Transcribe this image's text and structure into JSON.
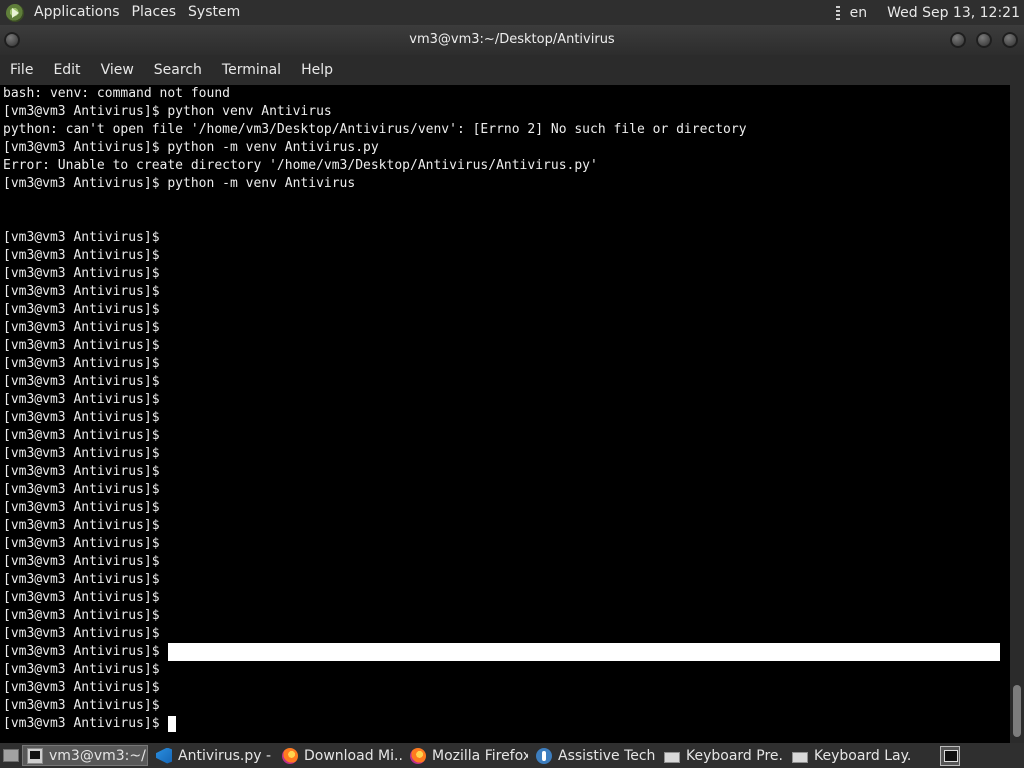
{
  "top_panel": {
    "menus": [
      "Applications",
      "Places",
      "System"
    ],
    "language": "en",
    "clock": "Wed Sep 13, 12:21"
  },
  "window": {
    "title": "vm3@vm3:~/Desktop/Antivirus"
  },
  "menubar": {
    "items": [
      "File",
      "Edit",
      "View",
      "Search",
      "Terminal",
      "Help"
    ]
  },
  "terminal": {
    "prompt": "[vm3@vm3 Antivirus]$",
    "lines": [
      "bash: venv: command not found",
      "[vm3@vm3 Antivirus]$ python venv Antivirus",
      "python: can't open file '/home/vm3/Desktop/Antivirus/venv': [Errno 2] No such file or directory",
      "[vm3@vm3 Antivirus]$ python -m venv Antivirus.py",
      "Error: Unable to create directory '/home/vm3/Desktop/Antivirus/Antivirus.py'",
      "[vm3@vm3 Antivirus]$ python -m venv Antivirus",
      "",
      "",
      "[vm3@vm3 Antivirus]$",
      "[vm3@vm3 Antivirus]$",
      "[vm3@vm3 Antivirus]$",
      "[vm3@vm3 Antivirus]$",
      "[vm3@vm3 Antivirus]$",
      "[vm3@vm3 Antivirus]$",
      "[vm3@vm3 Antivirus]$",
      "[vm3@vm3 Antivirus]$",
      "[vm3@vm3 Antivirus]$",
      "[vm3@vm3 Antivirus]$",
      "[vm3@vm3 Antivirus]$",
      "[vm3@vm3 Antivirus]$",
      "[vm3@vm3 Antivirus]$",
      "[vm3@vm3 Antivirus]$",
      "[vm3@vm3 Antivirus]$",
      "[vm3@vm3 Antivirus]$",
      "[vm3@vm3 Antivirus]$",
      "[vm3@vm3 Antivirus]$",
      "[vm3@vm3 Antivirus]$",
      "[vm3@vm3 Antivirus]$",
      "[vm3@vm3 Antivirus]$",
      "[vm3@vm3 Antivirus]$",
      "[vm3@vm3 Antivirus]$",
      "[vm3@vm3 Antivirus]$",
      "[vm3@vm3 Antivirus]$",
      "[vm3@vm3 Antivirus]$",
      "[vm3@vm3 Antivirus]$",
      "[vm3@vm3 Antivirus]$"
    ],
    "selected_line_index": 31,
    "cursor_line_index": 35
  },
  "taskbar": {
    "tasks": [
      {
        "label": "vm3@vm3:~/...",
        "icon": "terminal-icon",
        "active": true
      },
      {
        "label": "Antivirus.py - ...",
        "icon": "vscode-icon",
        "active": false
      },
      {
        "label": "Download Mi...",
        "icon": "firefox-icon",
        "active": false
      },
      {
        "label": "Mozilla Firefox",
        "icon": "firefox-icon",
        "active": false
      },
      {
        "label": "Assistive Tech...",
        "icon": "accessibility-icon",
        "active": false
      },
      {
        "label": "Keyboard Pre...",
        "icon": "keyboard-icon",
        "active": false
      },
      {
        "label": "Keyboard Lay...",
        "icon": "keyboard-icon",
        "active": false
      }
    ]
  }
}
